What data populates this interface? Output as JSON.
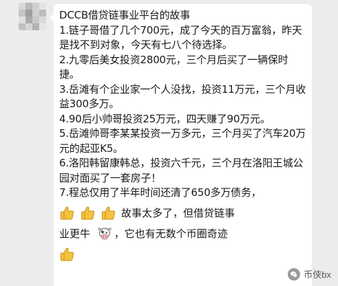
{
  "message": {
    "title": "DCCB借贷链事业平台的故事",
    "lines": [
      "1.链子哥借了几个700元，成了今天的百万富翁，昨天是找不到对象，今天有七八个待选择。",
      "2.九零后美女投资2800元，三个月后买了一辆保时捷。",
      "3.岳滩有个企业家一个人没找，投资11万元，三个月收益300多万。",
      "4.90后小帅哥投资25万元，四天赚了90万元。",
      "5.岳滩帅哥李某某投资一万多元，三个月买了汽车20万元的起亚K5。",
      "6.洛阳韩留康韩总，投资六千元，三个月在洛阳王城公园对面买了一套房子！",
      "7.程总仅用了半年时间还清了650多万债务，"
    ],
    "closing_1": "故事太多了，但借贷链事",
    "closing_2": "业更牛",
    "closing_3": "，它也有无数个币圈奇迹"
  },
  "emojis": {
    "thumbs_up": "thumbs-up-icon",
    "cow": "cow-face-icon"
  },
  "watermark": {
    "text": "币侠bx"
  }
}
